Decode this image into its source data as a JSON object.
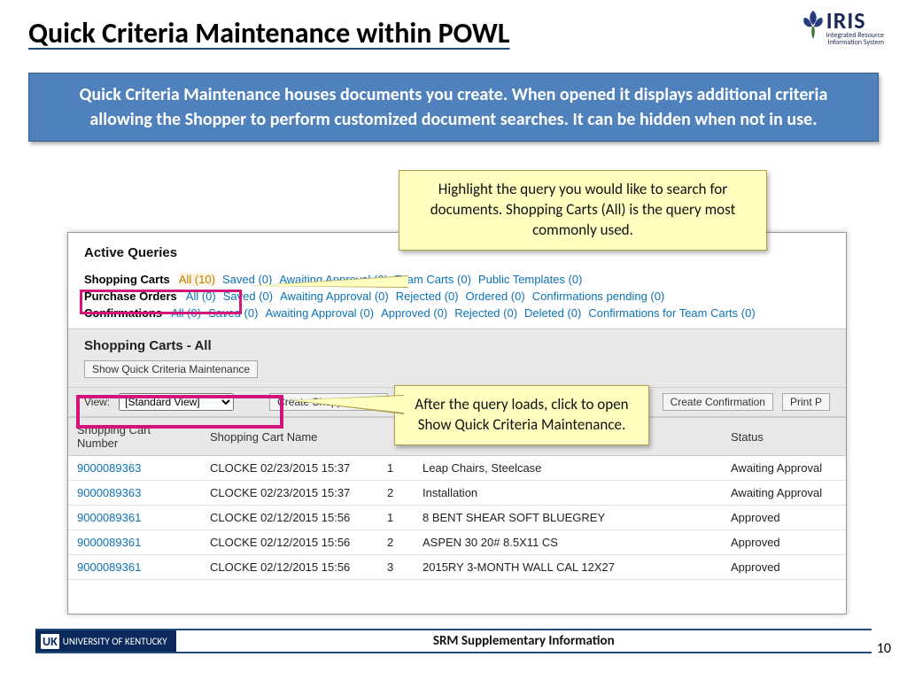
{
  "title": "Quick Criteria Maintenance within POWL",
  "iris": {
    "brand": "IRIS",
    "line1": "Integrated Resource",
    "line2": "Information System"
  },
  "infoBox": "Quick Criteria Maintenance houses documents you create. When opened it displays additional criteria allowing the Shopper to perform customized document searches. It can be hidden when not in use.",
  "callout1": "Highlight the query you would like to search for documents. Shopping Carts (All) is the query most commonly used.",
  "callout2": "After the query loads, click to open Show Quick Criteria Maintenance.",
  "activeQueries": {
    "heading": "Active Queries",
    "rows": [
      {
        "label": "Shopping Carts",
        "links": [
          "All (10)",
          "Saved (0)",
          "Awaiting Approval (0)",
          "Team Carts (0)",
          "Public Templates (0)"
        ],
        "selected": 0
      },
      {
        "label": "Purchase Orders",
        "links": [
          "All (0)",
          "Saved (0)",
          "Awaiting Approval (0)",
          "Rejected (0)",
          "Ordered (0)",
          "Confirmations pending (0)"
        ],
        "selected": -1
      },
      {
        "label": "Confirmations",
        "links": [
          "All (0)",
          "Saved (0)",
          "Awaiting Approval (0)",
          "Approved (0)",
          "Rejected (0)",
          "Deleted (0)",
          "Confirmations for Team Carts (0)"
        ],
        "selected": -1
      }
    ]
  },
  "panel": {
    "title": "Shopping Carts - All",
    "showQCM": "Show Quick Criteria Maintenance"
  },
  "toolbar": {
    "viewLabel": "View:",
    "viewValue": "[Standard View]",
    "createCart": "Create Shopping Cart",
    "createConf": "Create Confirmation",
    "print": "Print P"
  },
  "table": {
    "headers": [
      "Shopping Cart Number",
      "Shopping Cart Name",
      "",
      "",
      "Status"
    ],
    "colWidths": [
      "150px",
      "200px",
      "40px",
      "auto",
      "140px"
    ],
    "rows": [
      [
        "9000089363",
        "CLOCKE 02/23/2015 15:37",
        "1",
        "Leap Chairs, Steelcase",
        "Awaiting Approval"
      ],
      [
        "9000089363",
        "CLOCKE 02/23/2015 15:37",
        "2",
        "Installation",
        "Awaiting Approval"
      ],
      [
        "9000089361",
        "CLOCKE 02/12/2015 15:56",
        "1",
        "8  BENT SHEAR SOFT BLUEGREY",
        "Approved"
      ],
      [
        "9000089361",
        "CLOCKE 02/12/2015 15:56",
        "2",
        "ASPEN 30 20# 8.5X11 CS",
        "Approved"
      ],
      [
        "9000089361",
        "CLOCKE 02/12/2015 15:56",
        "3",
        "2015RY 3-MONTH WALL CAL 12X27",
        "Approved"
      ]
    ]
  },
  "footer": {
    "badge": "UNIVERSITY OF KENTUCKY",
    "uk": "UK",
    "title": "SRM Supplementary Information",
    "page": "10"
  }
}
